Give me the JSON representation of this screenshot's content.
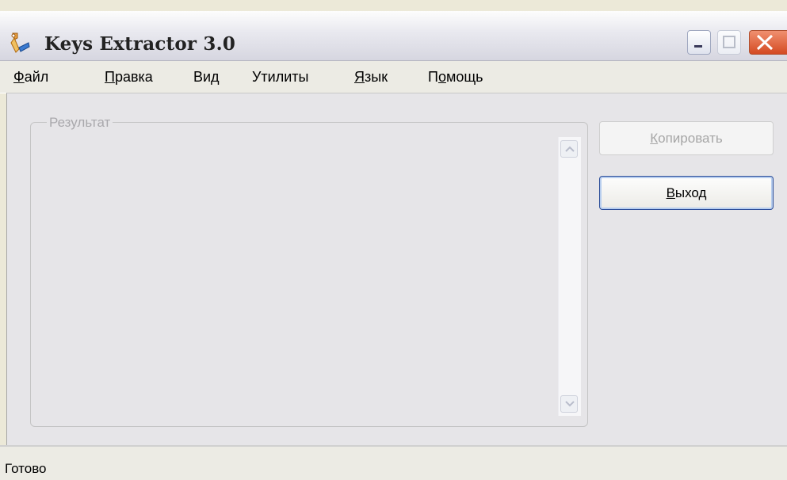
{
  "window": {
    "title": "Keys Extractor 3.0"
  },
  "menu": [
    {
      "pre": "",
      "key": "Ф",
      "post": "айл"
    },
    {
      "pre": "",
      "key": "П",
      "post": "равка"
    },
    {
      "pre": "Вид",
      "key": "",
      "post": ""
    },
    {
      "pre": "Утилиты",
      "key": "",
      "post": ""
    },
    {
      "pre": "",
      "key": "Я",
      "post": "зык"
    },
    {
      "pre": "П",
      "key": "о",
      "post": "мощь"
    }
  ],
  "result_group": {
    "legend": "Результат"
  },
  "buttons": {
    "copy": {
      "key": "К",
      "rest": "опировать"
    },
    "exit": {
      "key": "В",
      "rest": "ыход"
    }
  },
  "status": {
    "text": "Готово"
  },
  "icons": {
    "app": "keys-extractor-app-icon",
    "minimize": "minimize-icon",
    "maximize": "maximize-icon",
    "close": "close-icon",
    "scroll_up": "chevron-up-icon",
    "scroll_down": "chevron-down-icon"
  }
}
